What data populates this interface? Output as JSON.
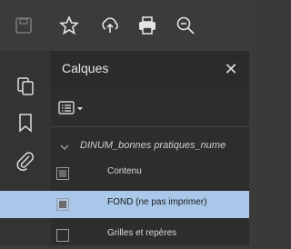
{
  "toolbar": {
    "icons": [
      "save-icon",
      "star-icon",
      "upload-icon",
      "print-icon",
      "zoom-out-icon"
    ]
  },
  "siderail": {
    "icons": [
      "pages-icon",
      "bookmark-icon",
      "attachment-icon",
      "layers-icon"
    ],
    "active": "layers-icon",
    "active_color": "#3a8fd6"
  },
  "panel": {
    "title": "Calques",
    "close_glyph": "✕",
    "root_layer": "DINUM_bonnes pratiques_nume",
    "layers": [
      {
        "label": "Contenu",
        "selected": false
      },
      {
        "label": "FOND (ne pas imprimer)",
        "selected": true
      },
      {
        "label": "Grilles et repères",
        "selected": false
      }
    ],
    "selected_color": "#a9c7e8"
  }
}
